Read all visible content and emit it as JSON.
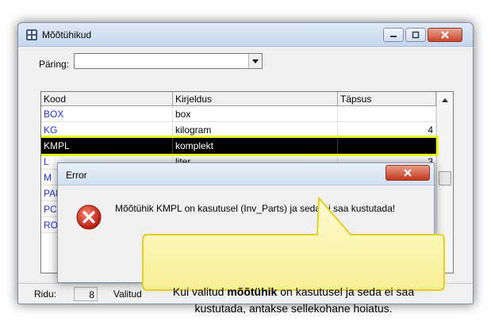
{
  "window": {
    "title": "Mõõtühikud",
    "query_label": "Päring:",
    "query_value": ""
  },
  "grid": {
    "columns": [
      "Kood",
      "Kirjeldus",
      "Täpsus"
    ],
    "rows": [
      {
        "code": "BOX",
        "description": "box",
        "precision": ""
      },
      {
        "code": "KG",
        "description": "kilogram",
        "precision": "4"
      },
      {
        "code": "KMPL",
        "description": "komplekt",
        "precision": "",
        "selected": true
      },
      {
        "code": "L",
        "description": "liter",
        "precision": "3"
      },
      {
        "code": "M",
        "description": "",
        "precision": ""
      },
      {
        "code": "PAK",
        "description": "",
        "precision": ""
      },
      {
        "code": "PCS",
        "description": "",
        "precision": ""
      },
      {
        "code": "ROLL",
        "description": "",
        "precision": ""
      }
    ]
  },
  "status": {
    "rows_label": "Ridu:",
    "rows_count": "8",
    "selected_label": "Valitud"
  },
  "error_dialog": {
    "title": "Error",
    "message": "Mõõtühik KMPL on kasutusel (Inv_Parts) ja seda ei saa kustutada!"
  },
  "callout": {
    "text_before": "Kui valitud ",
    "text_bold": "mõõtühik",
    "text_after": " on kasutusel ja seda ei saa kustutada, antakse sellekohane hoiatus."
  },
  "colors": {
    "callout_fill": "#fbf7b7",
    "callout_border": "#e4cf28",
    "highlight": "#e8f51a",
    "code_text": "#1f34d6"
  },
  "icons": {
    "app": "app-window-icon",
    "error": "error-x-icon"
  }
}
